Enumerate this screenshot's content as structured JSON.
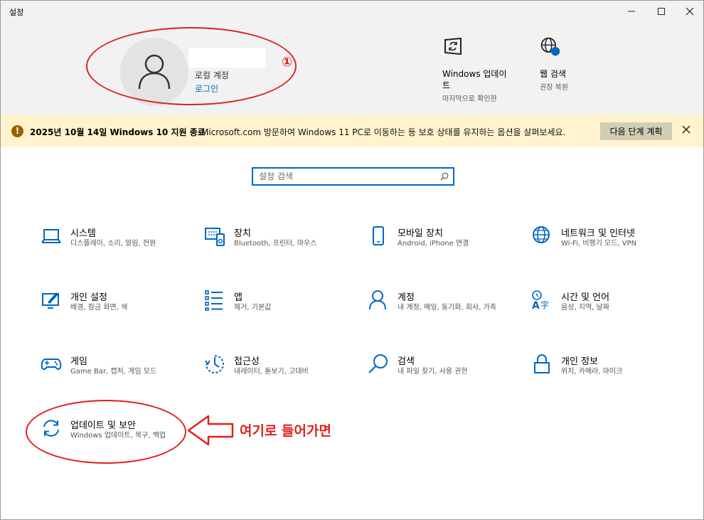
{
  "window": {
    "title": "설정"
  },
  "profile": {
    "account_type": "로컬 계정",
    "sign_in": "로그인",
    "annotation": "①"
  },
  "quick": [
    {
      "title": "Windows 업데이트",
      "title_l1": "Windows 업데이",
      "title_l2": "트",
      "sub": "마지막으로 확인한",
      "icon": "windows-update-icon"
    },
    {
      "title": "웹 검색",
      "sub": "권장 복원",
      "icon": "web-search-icon"
    }
  ],
  "banner": {
    "title": "2025년 10월 14일 Windows 10 지원 종료",
    "message": "Microsoft.com 방문하여 Windows 11 PC로 이동하는 등 보호 상태를 유지하는 옵션을 살펴보세요.",
    "button": "다음 단계 계획"
  },
  "search": {
    "placeholder": "설정 검색"
  },
  "categories": [
    {
      "title": "시스템",
      "sub": "디스플레이, 소리, 알림, 전원",
      "icon": "laptop-icon"
    },
    {
      "title": "장치",
      "sub": "Bluetooth, 프린터, 마우스",
      "icon": "devices-icon"
    },
    {
      "title": "모바일 장치",
      "sub": "Android, iPhone 연결",
      "icon": "phone-icon"
    },
    {
      "title": "네트워크 및 인터넷",
      "sub": "Wi-Fi, 비행기 모드, VPN",
      "icon": "globe-icon"
    },
    {
      "title": "개인 설정",
      "sub": "배경, 잠금 화면, 색",
      "icon": "personalization-icon"
    },
    {
      "title": "앱",
      "sub": "제거, 기본값",
      "icon": "apps-icon"
    },
    {
      "title": "계정",
      "sub": "내 계정, 메일, 동기화, 회사, 가족",
      "icon": "person-icon"
    },
    {
      "title": "시간 및 언어",
      "sub": "음성, 지역, 날짜",
      "icon": "time-language-icon"
    },
    {
      "title": "게임",
      "sub": "Game Bar, 캡처, 게임 모드",
      "icon": "gamepad-icon"
    },
    {
      "title": "접근성",
      "sub": "내레이터, 돋보기, 고대비",
      "icon": "accessibility-icon"
    },
    {
      "title": "검색",
      "sub": "내 파일 찾기, 사용 권한",
      "icon": "search-icon"
    },
    {
      "title": "개인 정보",
      "sub": "위치, 카메라, 마이크",
      "icon": "lock-icon"
    },
    {
      "title": "업데이트 및 보안",
      "sub": "Windows 업데이트, 복구, 백업",
      "icon": "sync-icon"
    }
  ],
  "annotation": {
    "text": "여기로 들어가면",
    "color": "#e0201a"
  },
  "colors": {
    "accent": "#0067c0",
    "banner_bg": "#fff4ce",
    "header_bg": "#f2f2f2"
  }
}
